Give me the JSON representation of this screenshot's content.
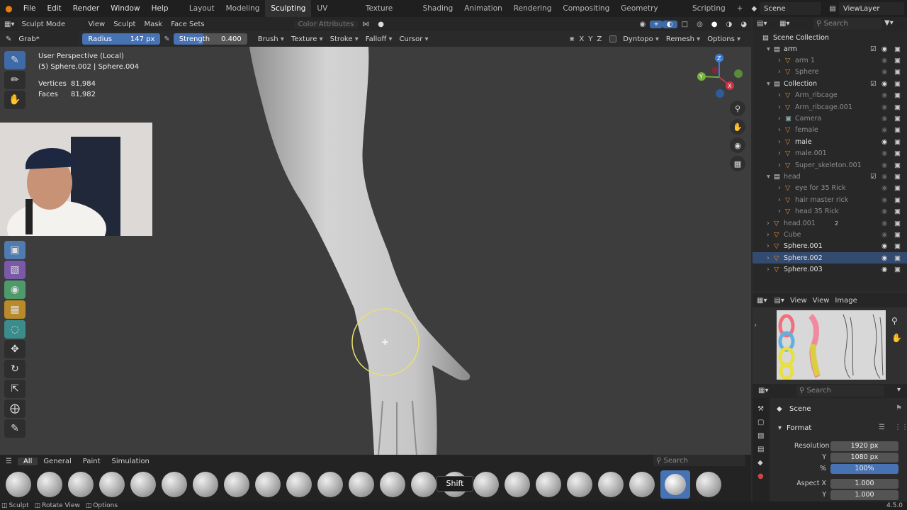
{
  "topbar": {
    "menus": [
      "File",
      "Edit",
      "Render",
      "Window",
      "Help"
    ],
    "workspaces": [
      "Layout",
      "Modeling",
      "Sculpting",
      "UV Editing",
      "Texture Paint",
      "Shading",
      "Animation",
      "Rendering",
      "Compositing",
      "Geometry Nodes",
      "Scripting"
    ],
    "active_workspace": "Sculpting",
    "add_tab": "+",
    "scene": "Scene",
    "view_layer": "ViewLayer"
  },
  "header": {
    "mode": "Sculpt Mode",
    "menus": [
      "View",
      "Sculpt",
      "Mask",
      "Face Sets"
    ],
    "color_attributes": "Color Attributes"
  },
  "toolheader": {
    "tool": "Grab*",
    "radius_label": "Radius",
    "radius_value": "147 px",
    "strength_label": "Strength",
    "strength_value": "0.400",
    "dropdowns": [
      "Brush",
      "Texture",
      "Stroke",
      "Falloff",
      "Cursor"
    ],
    "axes": [
      "X",
      "Y",
      "Z"
    ],
    "dyntopo": "Dyntopo",
    "remesh": "Remesh",
    "options": "Options"
  },
  "overlay": {
    "view_name": "User Perspective (Local)",
    "object_info": "(5) Sphere.002 | Sphere.004",
    "vertices_label": "Vertices",
    "vertices_value": "81,984",
    "faces_label": "Faces",
    "faces_value": "81,982"
  },
  "navgizmo": {
    "x": "X",
    "y": "Y",
    "z": "Z"
  },
  "brush_tabs": [
    "All",
    "General",
    "Paint",
    "Simulation"
  ],
  "brush_search_placeholder": "Search",
  "shift_tooltip": "Shift",
  "status": {
    "sculpt": "Sculpt",
    "rotate": "Rotate View",
    "options": "Options",
    "version": "4.5.0"
  },
  "outliner": {
    "search_placeholder": "Search",
    "root": "Scene Collection",
    "rows": [
      {
        "label": "arm",
        "kind": "collection"
      },
      {
        "label": "arm 1",
        "kind": "object"
      },
      {
        "label": "Sphere",
        "kind": "object"
      },
      {
        "label": "Collection",
        "kind": "collection"
      },
      {
        "label": "Arm_ribcage",
        "kind": "object"
      },
      {
        "label": "Arm_ribcage.001",
        "kind": "object"
      },
      {
        "label": "Camera",
        "kind": "camera"
      },
      {
        "label": "female",
        "kind": "object"
      },
      {
        "label": "male",
        "kind": "object"
      },
      {
        "label": "male.001",
        "kind": "object"
      },
      {
        "label": "Super_skeleton.001",
        "kind": "object"
      },
      {
        "label": "head",
        "kind": "collection"
      },
      {
        "label": "eye for 35 Rick",
        "kind": "object"
      },
      {
        "label": "hair master rick",
        "kind": "object"
      },
      {
        "label": "head 35 Rick",
        "kind": "object"
      },
      {
        "label": "head.001",
        "kind": "object"
      },
      {
        "label": "Cube",
        "kind": "object"
      },
      {
        "label": "Sphere.001",
        "kind": "object"
      },
      {
        "label": "Sphere.002",
        "kind": "object"
      },
      {
        "label": "Sphere.003",
        "kind": "object"
      }
    ],
    "head001_badge": "2"
  },
  "image_editor": {
    "view1": "View",
    "view2": "View",
    "image": "Image"
  },
  "properties": {
    "search_placeholder": "Search",
    "scene_label": "Scene",
    "format_label": "Format",
    "res_x_label": "Resolution X",
    "res_x": "1920 px",
    "res_y_label": "Y",
    "res_y": "1080 px",
    "pct_label": "%",
    "pct": "100%",
    "aspect_x_label": "Aspect X",
    "aspect_x": "1.000",
    "aspect_y_label": "Y",
    "aspect_y": "1.000"
  }
}
